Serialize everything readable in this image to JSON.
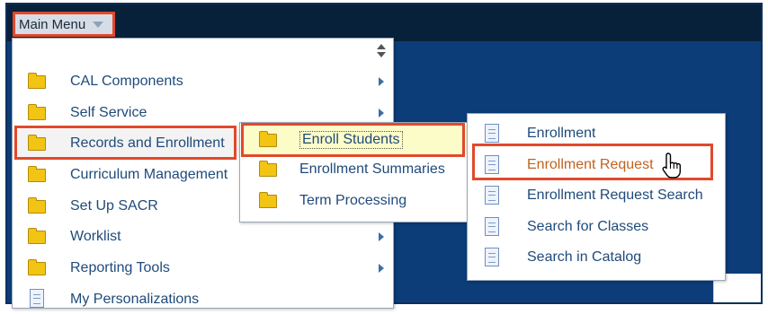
{
  "topbar": {
    "main_menu_label": "Main Menu"
  },
  "menu1": {
    "items": [
      {
        "label": "CAL Components",
        "icon": "folder-icon",
        "has_submenu": true
      },
      {
        "label": "Self Service",
        "icon": "folder-icon",
        "has_submenu": true
      },
      {
        "label": "Records and Enrollment",
        "icon": "folder-icon",
        "has_submenu": true
      },
      {
        "label": "Curriculum Management",
        "icon": "folder-icon",
        "has_submenu": true
      },
      {
        "label": "Set Up SACR",
        "icon": "folder-icon",
        "has_submenu": true
      },
      {
        "label": "Worklist",
        "icon": "folder-icon",
        "has_submenu": true
      },
      {
        "label": "Reporting Tools",
        "icon": "folder-icon",
        "has_submenu": true
      },
      {
        "label": "My Personalizations",
        "icon": "document-icon",
        "has_submenu": false
      }
    ]
  },
  "menu2": {
    "items": [
      {
        "label": "Enroll Students",
        "icon": "folder-icon"
      },
      {
        "label": "Enrollment Summaries",
        "icon": "folder-icon"
      },
      {
        "label": "Term Processing",
        "icon": "folder-icon"
      }
    ]
  },
  "menu3": {
    "items": [
      {
        "label": "Enrollment",
        "icon": "document-icon"
      },
      {
        "label": "Enrollment Request",
        "icon": "document-icon"
      },
      {
        "label": "Enrollment Request Search",
        "icon": "document-icon"
      },
      {
        "label": "Search for Classes",
        "icon": "document-icon"
      },
      {
        "label": "Search in Catalog",
        "icon": "document-icon"
      }
    ]
  },
  "colors": {
    "highlight_border": "#e1492c",
    "link_text": "#1f4a7a",
    "hover_link_text": "#c0621f",
    "folder": "#f2c414",
    "topbar_bg": "#08213a",
    "page_bg": "#0c3d78"
  },
  "cursor": {
    "icon": "hand-pointer-icon"
  }
}
